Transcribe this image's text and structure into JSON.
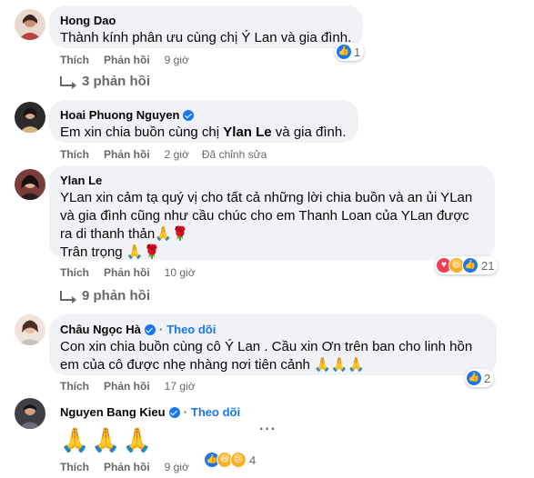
{
  "comments": [
    {
      "author": "Hong Dao",
      "text": "Thành kính phân ưu cùng chị Ý Lan và gia đình.",
      "like_label": "Thích",
      "reply_label": "Phản hồi",
      "time": "9 giờ",
      "reaction_count": "1",
      "replies_label": "3 phản hồi"
    },
    {
      "author": "Hoai Phuong Nguyen",
      "text_before": "Em xin chia buồn cùng chị ",
      "mention": "Ylan Le",
      "text_after": " và gia đình.",
      "like_label": "Thích",
      "reply_label": "Phản hồi",
      "time": "2 giờ",
      "edited_label": "Đã chỉnh sửa"
    },
    {
      "author": "Ylan Le",
      "text_line1": "YLan xin cảm tạ quý vị cho tất cả những lời chia buồn và an ủi YLan",
      "text_line2": "và gia đình cũng như cầu chúc cho em Thanh Loan của YLan được",
      "text_line3": "ra di thanh thản🙏🌹",
      "text_line4": "Trân trọng 🙏🌹",
      "like_label": "Thích",
      "reply_label": "Phản hồi",
      "time": "10 giờ",
      "reaction_count": "21",
      "replies_label": "9 phản hồi"
    },
    {
      "author": "Châu Ngọc Hà",
      "follow_label": "Theo dõi",
      "text_line1": "Con xin chia buồn cùng cô Ý Lan . Cầu xin Ơn trên ban cho linh hồn",
      "text_line2": "em của cô được nhẹ nhàng nơi tiên cảnh 🙏🙏🙏",
      "like_label": "Thích",
      "reply_label": "Phản hồi",
      "time": "17 giờ",
      "reaction_count": "2"
    },
    {
      "author": "Nguyen Bang Kieu",
      "follow_label": "Theo dõi",
      "text": "🙏🙏🙏",
      "like_label": "Thích",
      "reply_label": "Phản hồi",
      "time": "9 giờ",
      "reaction_count": "4"
    }
  ],
  "separator": "·",
  "colors": {
    "bubble": "#f0f2f5",
    "meta": "#65676b",
    "accent": "#1877f2"
  },
  "icons": [
    "verified-badge-icon",
    "reply-arrow-icon",
    "like-reaction-icon",
    "love-reaction-icon",
    "haha-reaction-icon",
    "sad-reaction-icon",
    "more-options-icon"
  ]
}
